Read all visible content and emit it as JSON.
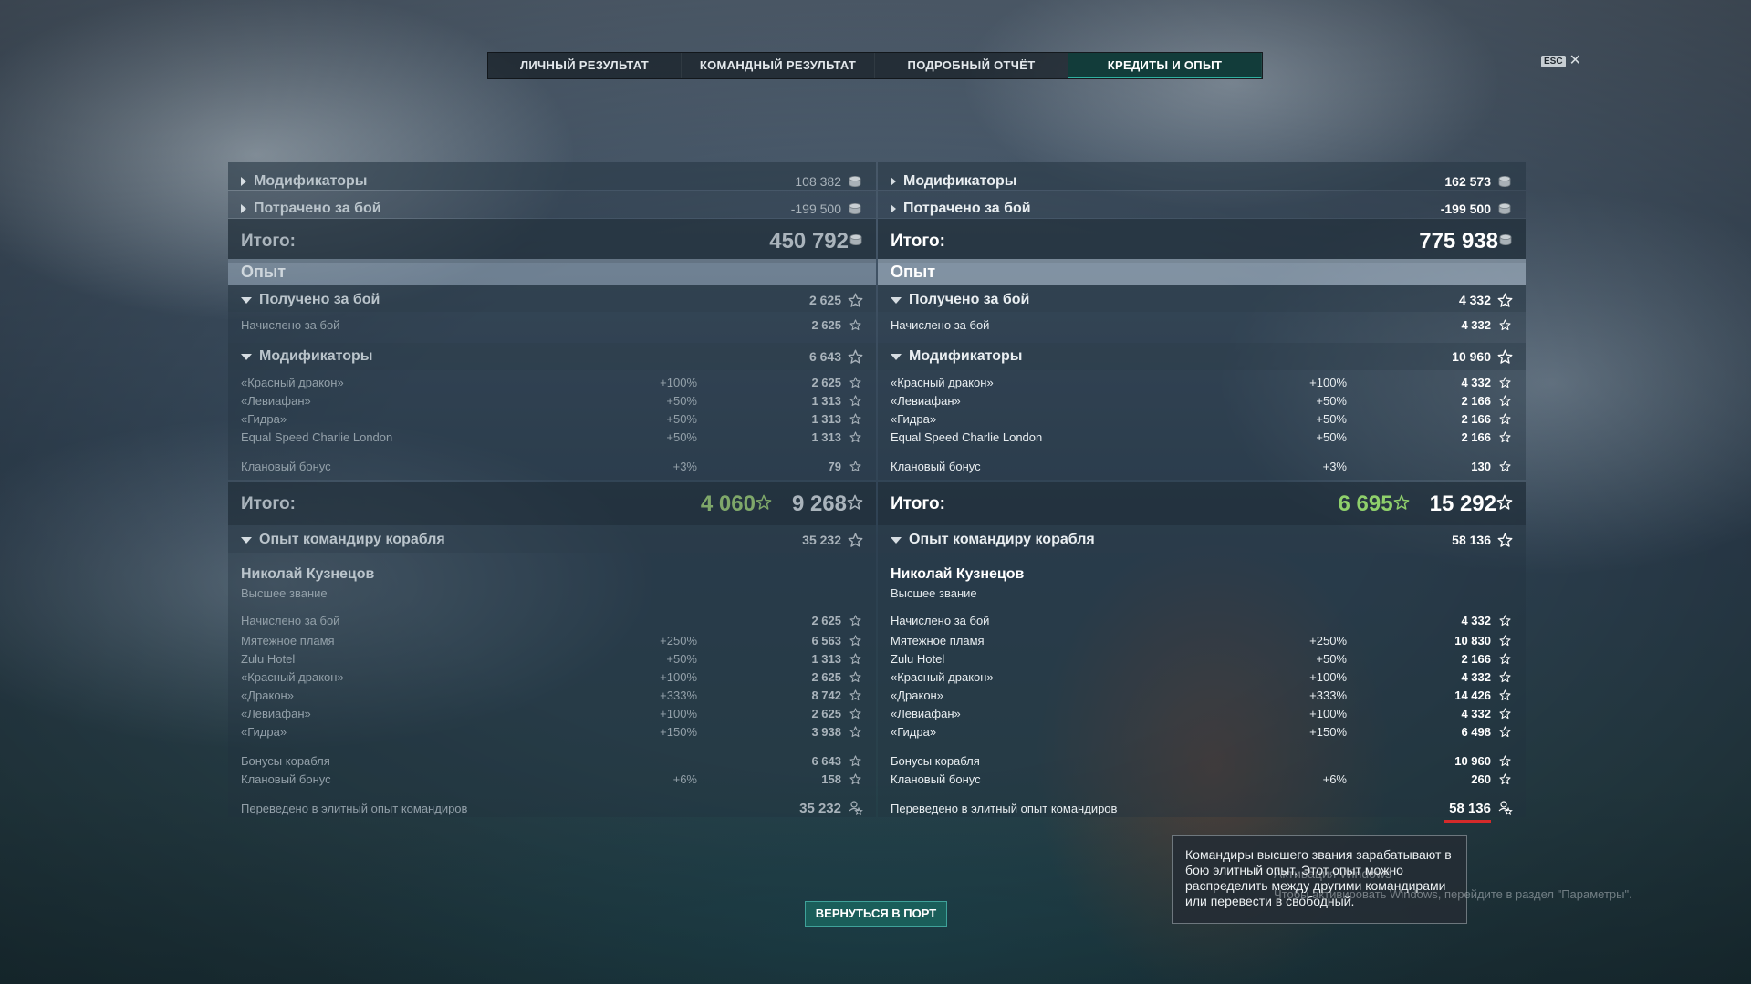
{
  "tabs": [
    {
      "label": "ЛИЧНЫЙ РЕЗУЛЬТАТ",
      "active": false
    },
    {
      "label": "КОМАНДНЫЙ РЕЗУЛЬТАТ",
      "active": false
    },
    {
      "label": "ПОДРОБНЫЙ ОТЧЁТ",
      "active": false
    },
    {
      "label": "КРЕДИТЫ И ОПЫТ",
      "active": true
    }
  ],
  "esc": {
    "key": "ESC",
    "close": "✕"
  },
  "left": {
    "credits": {
      "modifiers": {
        "label": "Модификаторы",
        "value": "108 382"
      },
      "spent": {
        "label": "Потрачено за бой",
        "value": "-199 500"
      },
      "total": {
        "label": "Итого:",
        "value": "450 792"
      }
    },
    "xp": {
      "header": "Опыт",
      "earned": {
        "label": "Получено за бой",
        "value": "2 625"
      },
      "accrued": {
        "label": "Начислено за бой",
        "value": "2 625"
      },
      "modifiers": {
        "label": "Модификаторы",
        "value": "6 643"
      },
      "modifier_rows": [
        {
          "label": "«Красный дракон»",
          "pct": "+100%",
          "value": "2 625"
        },
        {
          "label": "«Левиафан»",
          "pct": "+50%",
          "value": "1 313"
        },
        {
          "label": "«Гидра»",
          "pct": "+50%",
          "value": "1 313"
        },
        {
          "label": "Equal Speed Charlie London",
          "pct": "+50%",
          "value": "1 313"
        }
      ],
      "clan": {
        "label": "Клановый бонус",
        "pct": "+3%",
        "value": "79"
      },
      "total": {
        "label": "Итого:",
        "premium": "4 060",
        "value": "9 268"
      }
    },
    "commander": {
      "title": {
        "label": "Опыт командиру корабля",
        "value": "35 232"
      },
      "name": "Николай Кузнецов",
      "rank": "Высшее звание",
      "accrued": {
        "label": "Начислено за бой",
        "value": "2 625"
      },
      "rows": [
        {
          "label": "Мятежное пламя",
          "pct": "+250%",
          "value": "6 563"
        },
        {
          "label": "Zulu Hotel",
          "pct": "+50%",
          "value": "1 313"
        },
        {
          "label": "«Красный дракон»",
          "pct": "+100%",
          "value": "2 625"
        },
        {
          "label": "«Дракон»",
          "pct": "+333%",
          "value": "8 742"
        },
        {
          "label": "«Левиафан»",
          "pct": "+100%",
          "value": "2 625"
        },
        {
          "label": "«Гидра»",
          "pct": "+150%",
          "value": "3 938"
        }
      ],
      "ship_bonus": {
        "label": "Бонусы корабля",
        "value": "6 643"
      },
      "clan": {
        "label": "Клановый бонус",
        "pct": "+6%",
        "value": "158"
      },
      "elite": {
        "label": "Переведено в элитный опыт командиров",
        "value": "35 232"
      }
    }
  },
  "right": {
    "credits": {
      "modifiers": {
        "label": "Модификаторы",
        "value": "162 573"
      },
      "spent": {
        "label": "Потрачено за бой",
        "value": "-199 500"
      },
      "total": {
        "label": "Итого:",
        "value": "775 938"
      }
    },
    "xp": {
      "header": "Опыт",
      "earned": {
        "label": "Получено за бой",
        "value": "4 332"
      },
      "accrued": {
        "label": "Начислено за бой",
        "value": "4 332"
      },
      "modifiers": {
        "label": "Модификаторы",
        "value": "10 960"
      },
      "modifier_rows": [
        {
          "label": "«Красный дракон»",
          "pct": "+100%",
          "value": "4 332"
        },
        {
          "label": "«Левиафан»",
          "pct": "+50%",
          "value": "2 166"
        },
        {
          "label": "«Гидра»",
          "pct": "+50%",
          "value": "2 166"
        },
        {
          "label": "Equal Speed Charlie London",
          "pct": "+50%",
          "value": "2 166"
        }
      ],
      "clan": {
        "label": "Клановый бонус",
        "pct": "+3%",
        "value": "130"
      },
      "total": {
        "label": "Итого:",
        "premium": "6 695",
        "value": "15 292"
      }
    },
    "commander": {
      "title": {
        "label": "Опыт командиру корабля",
        "value": "58 136"
      },
      "name": "Николай Кузнецов",
      "rank": "Высшее звание",
      "accrued": {
        "label": "Начислено за бой",
        "value": "4 332"
      },
      "rows": [
        {
          "label": "Мятежное пламя",
          "pct": "+250%",
          "value": "10 830"
        },
        {
          "label": "Zulu Hotel",
          "pct": "+50%",
          "value": "2 166"
        },
        {
          "label": "«Красный дракон»",
          "pct": "+100%",
          "value": "4 332"
        },
        {
          "label": "«Дракон»",
          "pct": "+333%",
          "value": "14 426"
        },
        {
          "label": "«Левиафан»",
          "pct": "+100%",
          "value": "4 332"
        },
        {
          "label": "«Гидра»",
          "pct": "+150%",
          "value": "6 498"
        }
      ],
      "ship_bonus": {
        "label": "Бонусы корабля",
        "value": "10 960"
      },
      "clan": {
        "label": "Клановый бонус",
        "pct": "+6%",
        "value": "260"
      },
      "elite": {
        "label": "Переведено в элитный опыт командиров",
        "value": "58 136"
      }
    }
  },
  "tooltip": {
    "text": "Командиры высшего звания зарабатывают в бою элитный опыт. Этот опыт можно распределить между другими командирами или перевести в свободный."
  },
  "return_button": "ВЕРНУТЬСЯ В ПОРТ",
  "watermark": {
    "line1": "Активация Windows",
    "line2": "Чтобы активировать Windows, перейдите в раздел \"Параметры\"."
  },
  "icons": {
    "credits": "silver-coin-icon",
    "xp": "star-icon",
    "elite_xp": "elite-commander-xp-icon",
    "expand": "triangle-right-icon",
    "collapse": "triangle-down-icon"
  },
  "colors": {
    "premium_green": "#8fd06b",
    "active_tab": "#123c3a",
    "button": "#1a5e5a",
    "underline": "#d42a2a"
  }
}
